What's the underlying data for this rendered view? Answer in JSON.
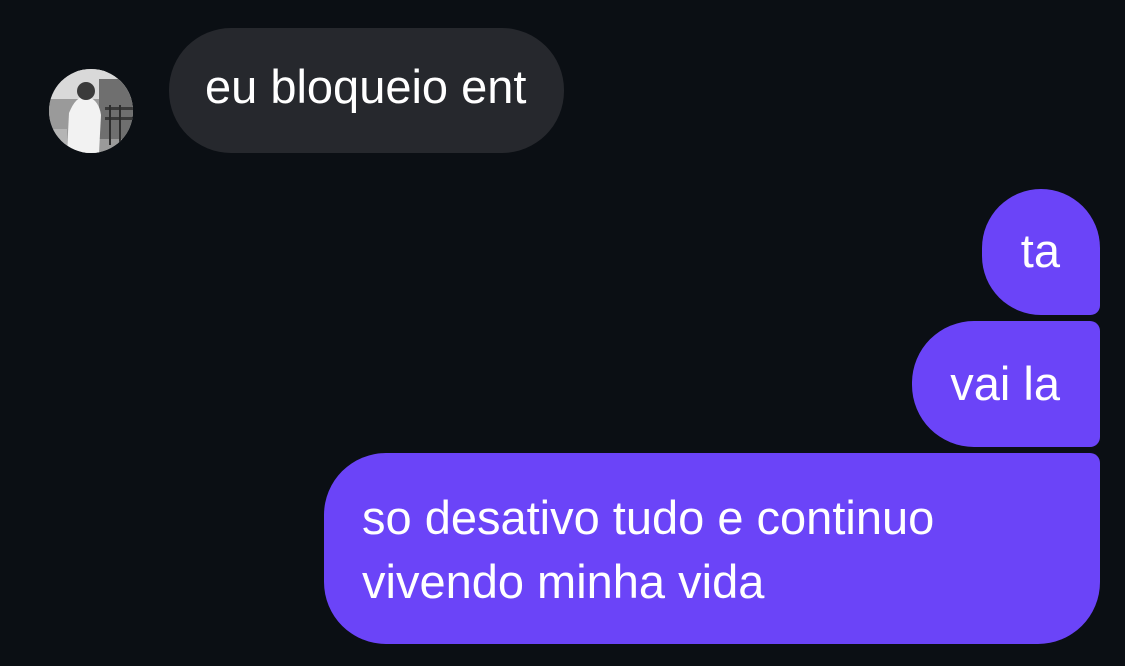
{
  "conversation": {
    "incoming": [
      {
        "text": "eu bloqueio ent"
      }
    ],
    "outgoing": [
      {
        "text": "ta"
      },
      {
        "text": "vai la"
      },
      {
        "lines": [
          "so desativo tudo e continuo",
          "vivendo minha vida"
        ]
      }
    ]
  },
  "colors": {
    "background": "#0b0f14",
    "incoming_bubble": "#26282d",
    "outgoing_bubble": "#6b44f8",
    "text": "#ffffff"
  }
}
